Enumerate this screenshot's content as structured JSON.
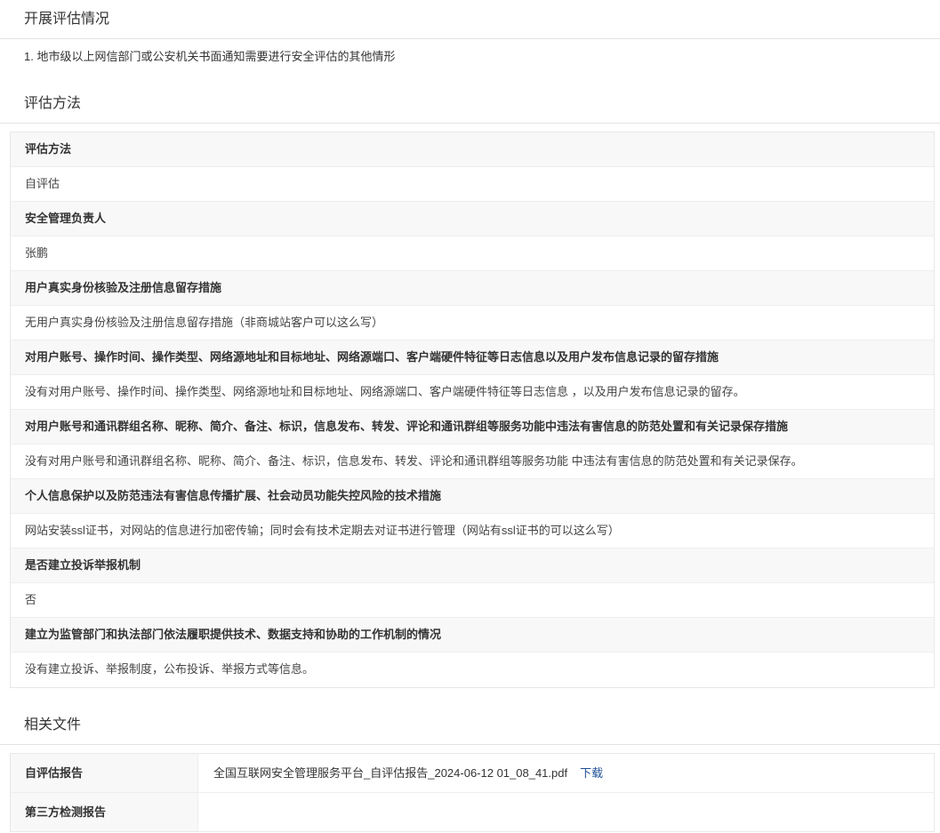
{
  "assessment": {
    "title": "开展评估情况",
    "items": [
      "1. 地市级以上网信部门或公安机关书面通知需要进行安全评估的其他情形"
    ]
  },
  "method": {
    "title": "评估方法",
    "rows": [
      {
        "label": "评估方法",
        "value": "自评估"
      },
      {
        "label": "安全管理负责人",
        "value": "张鹏"
      },
      {
        "label": "用户真实身份核验及注册信息留存措施",
        "value": "无用户真实身份核验及注册信息留存措施（非商城站客户可以这么写）"
      },
      {
        "label": "对用户账号、操作时间、操作类型、网络源地址和目标地址、网络源端口、客户端硬件特征等日志信息以及用户发布信息记录的留存措施",
        "value": "没有对用户账号、操作时间、操作类型、网络源地址和目标地址、网络源端口、客户端硬件特征等日志信息 ，以及用户发布信息记录的留存。"
      },
      {
        "label": "对用户账号和通讯群组名称、昵称、简介、备注、标识，信息发布、转发、评论和通讯群组等服务功能中违法有害信息的防范处置和有关记录保存措施",
        "value": "没有对用户账号和通讯群组名称、昵称、简介、备注、标识，信息发布、转发、评论和通讯群组等服务功能 中违法有害信息的防范处置和有关记录保存。"
      },
      {
        "label": "个人信息保护以及防范违法有害信息传播扩展、社会动员功能失控风险的技术措施",
        "value": "网站安装ssl证书，对网站的信息进行加密传输；同时会有技术定期去对证书进行管理（网站有ssl证书的可以这么写）"
      },
      {
        "label": "是否建立投诉举报机制",
        "value": "否"
      },
      {
        "label": "建立为监管部门和执法部门依法履职提供技术、数据支持和协助的工作机制的情况",
        "value": "没有建立投诉、举报制度，公布投诉、举报方式等信息。"
      }
    ]
  },
  "files": {
    "title": "相关文件",
    "rows": [
      {
        "label": "自评估报告",
        "file": "全国互联网安全管理服务平台_自评估报告_2024-06-12 01_08_41.pdf",
        "link": "下载"
      },
      {
        "label": "第三方检测报告",
        "file": "",
        "link": ""
      }
    ]
  },
  "colors": {
    "link": "#1f4e96",
    "label_bg": "#f8f8f8",
    "border": "#e8e8e8"
  }
}
